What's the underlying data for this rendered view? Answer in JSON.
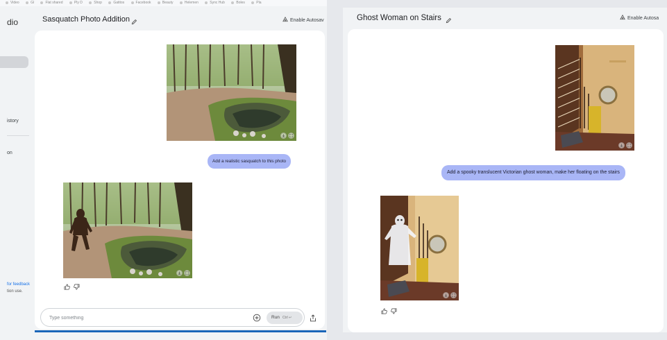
{
  "bookmarks_bar": {
    "items": [
      "Video",
      "Gl",
      "Flat shared",
      "Ply D",
      "Shop",
      "Gatitos",
      "Facebook",
      "Beauty",
      "Helemen",
      "Sync Hub",
      "Boles",
      "Pla"
    ]
  },
  "left_window": {
    "sidebar": {
      "app_title": "dio",
      "history_label": "istory",
      "other_label": "on",
      "feedback_text": "for feedback",
      "terms_text": "tion use."
    },
    "header": {
      "title": "Sasquatch Photo Addition",
      "autosave_label": "Enable Autosav"
    },
    "chat": {
      "user_prompt": "Add a realistic sasquatch to this photo"
    },
    "composer": {
      "placeholder": "Type something",
      "run_label": "Run",
      "run_shortcut": "Ctrl ↵"
    }
  },
  "right_window": {
    "header": {
      "title": "Ghost Woman on Stairs",
      "autosave_label": "Enable Autosa"
    },
    "chat": {
      "user_prompt": "Add a spooky translucent Victorian ghost woman, make her floating on the stairs"
    }
  },
  "colors": {
    "user_bubble": "#a9b6f6",
    "accent_bar": "#1a65b8",
    "canvas": "#ffffff",
    "chrome": "#f1f3f5"
  },
  "icons": [
    "pencil-icon",
    "autosave-icon",
    "download-icon",
    "expand-icon",
    "thumbs-up-icon",
    "thumbs-down-icon",
    "add-circle-icon",
    "share-icon"
  ]
}
